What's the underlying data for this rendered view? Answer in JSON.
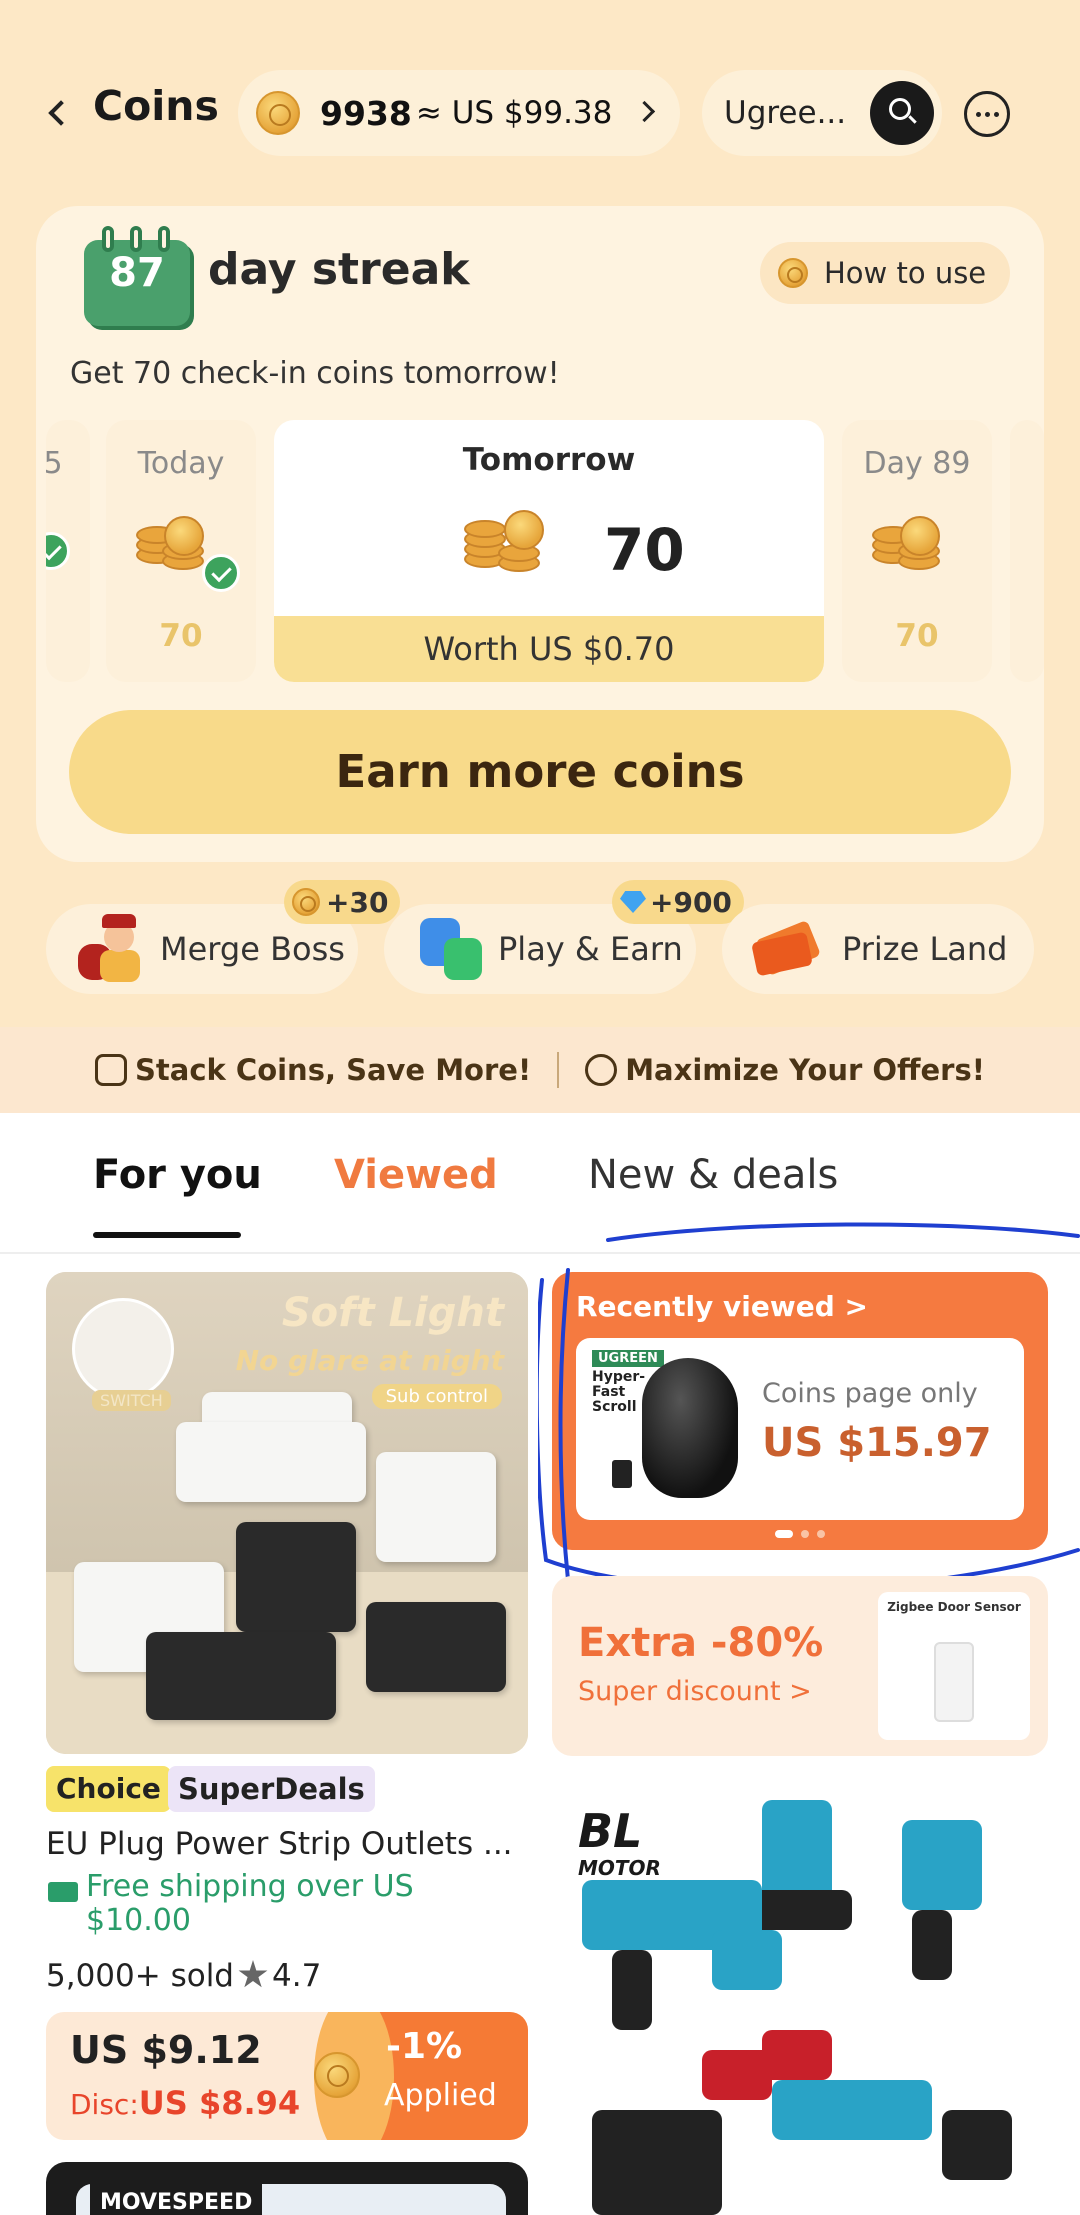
{
  "header": {
    "title": "Coins",
    "coin_count": "9938",
    "coin_value": "≈ US $99.38",
    "search_text": "Ugree..."
  },
  "streak": {
    "days": "87",
    "title": "day streak",
    "how_to_use": "How to use",
    "subtitle": "Get 70 check-in coins tomorrow!",
    "prev_day_partial": "5",
    "today_label": "Today",
    "today_value": "70",
    "tomorrow_label": "Tomorrow",
    "tomorrow_value": "70",
    "tomorrow_worth": "Worth US $0.70",
    "day89_label": "Day 89",
    "day89_value": "70",
    "earn_button": "Earn more coins"
  },
  "games": [
    {
      "label": "Merge Boss",
      "badge": "+30"
    },
    {
      "label": "Play & Earn",
      "badge": "+900"
    },
    {
      "label": "Prize Land"
    }
  ],
  "promo": {
    "left": "Stack Coins, Save More!",
    "right": "Maximize Your Offers!"
  },
  "tabs": {
    "for_you": "For you",
    "viewed": "Viewed",
    "new_deals": "New & deals"
  },
  "product1": {
    "img_title": "Soft Light",
    "img_subtitle": "No glare at night",
    "img_chip": "Sub control",
    "img_switch": "SWITCH",
    "tag_choice": "Choice",
    "tag_super": "SuperDeals",
    "name": "EU Plug Power Strip Outlets ...",
    "shipping": "Free shipping over US $10.00",
    "sold": "5,000+ sold",
    "rating": "4.7",
    "price": "US $9.12",
    "disc_label": "Disc:",
    "disc_price": "US $8.94",
    "pct": "-1%",
    "applied": "Applied"
  },
  "recent": {
    "title": "Recently viewed >",
    "brand": "UGREEN",
    "feature": "Hyper-Fast Scroll",
    "coins_only": "Coins page only",
    "price": "US $15.97"
  },
  "extra": {
    "title": "Extra -80%",
    "subtitle": "Super discount >",
    "product_title": "Zigbee Door Sensor"
  },
  "tools": {
    "logo": "BL",
    "logo_sub": "MOTOR"
  },
  "next_card": {
    "brand": "MOVESPEED"
  },
  "colors": {
    "background_top": "#fde8c6",
    "accent_orange": "#f57a40",
    "earn_button": "#f8da8a",
    "shipping_green": "#2a9d6a"
  }
}
